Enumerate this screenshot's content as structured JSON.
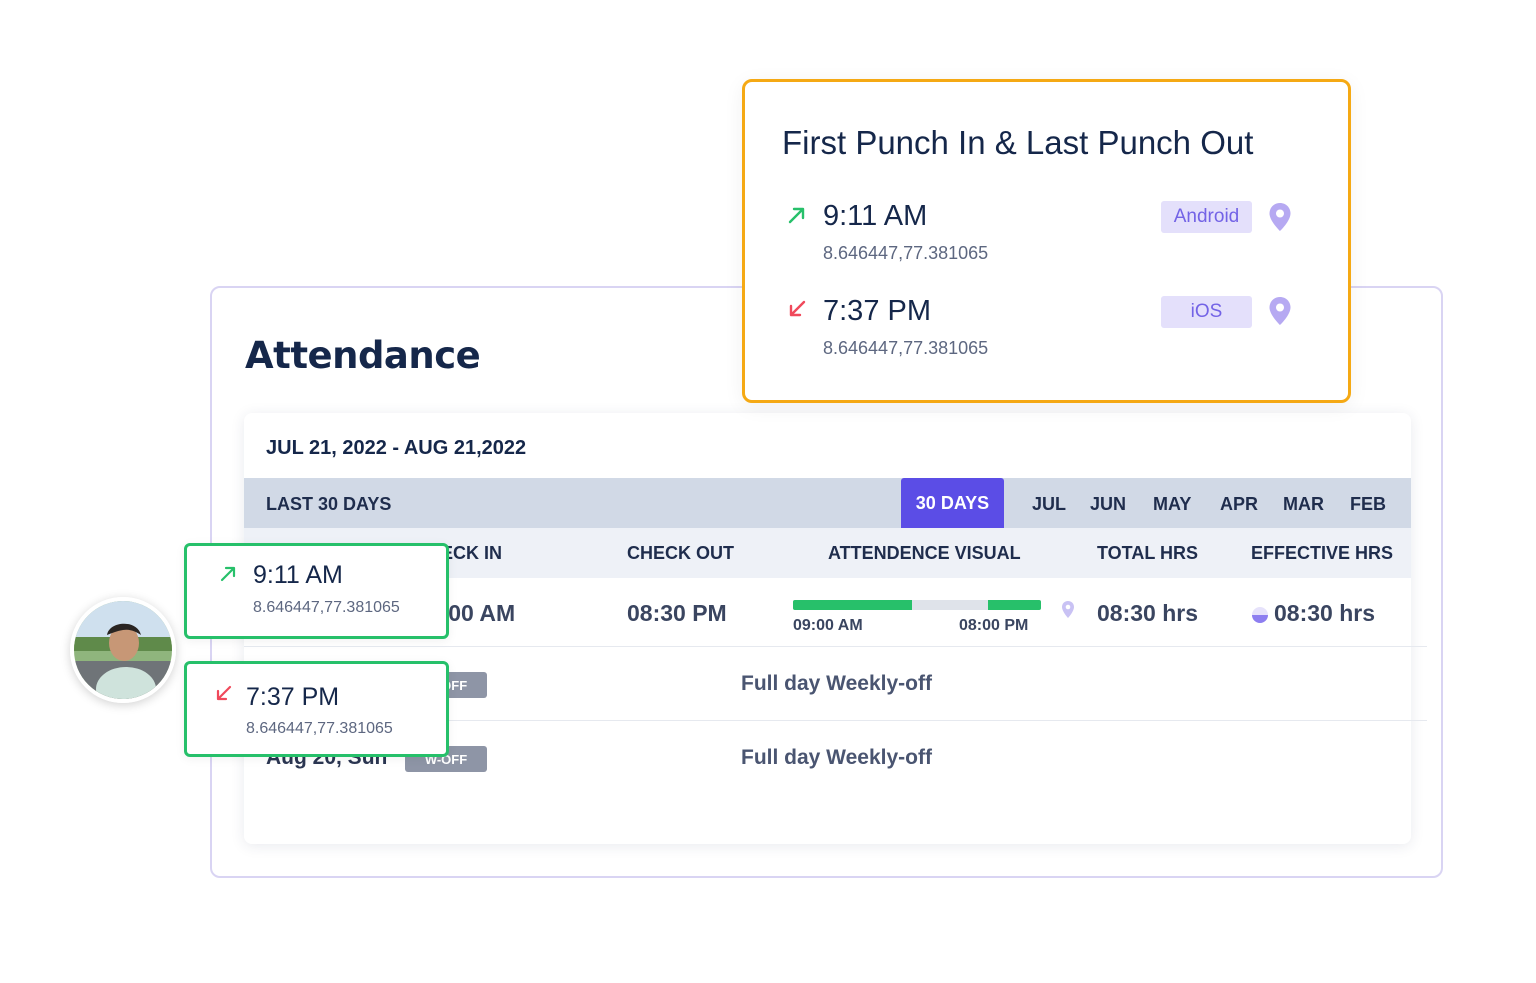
{
  "attendance": {
    "title": "Attendance",
    "date_range": "JUL 21, 2022 - AUG 21,2022",
    "filter_label": "LAST 30 DAYS",
    "active_filter": "30 DAYS",
    "months": [
      "JUL",
      "JUN",
      "MAY",
      "APR",
      "MAR",
      "FEB"
    ],
    "columns": {
      "check_in": "CHECK IN",
      "check_out": "CHECK OUT",
      "visual": "ATTENDENCE VISUAL",
      "total_hrs": "TOTAL HRS",
      "effective_hrs": "EFFECTIVE HRS"
    },
    "row1": {
      "check_in": "09:00 AM",
      "check_out": "08:30 PM",
      "visual_start": "09:00 AM",
      "visual_end": "08:00 PM",
      "total_hrs": "08:30 hrs",
      "effective_hrs": "08:30 hrs"
    },
    "row2": {
      "badge": "W-OFF",
      "status": "Full day Weekly-off"
    },
    "row3": {
      "date": "Aug 20, Sun",
      "badge": "W-OFF",
      "status": "Full day Weekly-off"
    }
  },
  "punch_card": {
    "title": "First Punch In & Last Punch Out",
    "punch_in": {
      "time": "9:11 AM",
      "coords": "8.646447,77.381065",
      "device": "Android"
    },
    "punch_out": {
      "time": "7:37 PM",
      "coords": "8.646447,77.381065",
      "device": "iOS"
    }
  },
  "float_in": {
    "time": "9:11 AM",
    "coords": "8.646447,77.381065"
  },
  "float_out": {
    "time": "7:37 PM",
    "coords": "8.646447,77.381065"
  },
  "colors": {
    "accent": "#5b4de6",
    "punch_border": "#f5a914",
    "green": "#26c06a",
    "out_arrow": "#f0495b"
  }
}
